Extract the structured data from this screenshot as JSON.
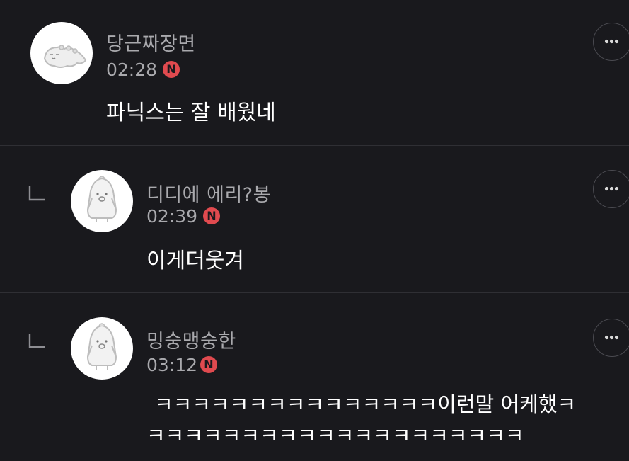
{
  "comments": [
    {
      "author": "당근짜장면",
      "time": "02:28",
      "badge": "N",
      "text": "파닉스는 잘 배웠네",
      "is_reply": false,
      "avatar": "dinosaur-avatar-icon"
    },
    {
      "author": "디디에 에리?봉",
      "time": "02:39",
      "badge": "N",
      "text": "이게더웃겨",
      "is_reply": true,
      "avatar": "penguin-avatar-icon"
    },
    {
      "author": "밍숭맹숭한",
      "time": "03:12",
      "badge": "N",
      "text_line1": "ㅋㅋㅋㅋㅋㅋㅋㅋㅋㅋㅋㅋㅋㅋㅋ이런말 어케했ㅋ",
      "text_line2": "ㅋㅋㅋㅋㅋㅋㅋㅋㅋㅋㅋㅋㅋㅋㅋㅋㅋㅋㅋㅋ",
      "is_reply": true,
      "avatar": "penguin-avatar-icon"
    }
  ],
  "icons": {
    "more": "more-options-icon",
    "reply": "reply-arrow-icon"
  },
  "colors": {
    "background": "#19191d",
    "divider": "#2f2f34",
    "meta_text": "#a9a9ad",
    "new_badge": "#e04a4f"
  }
}
